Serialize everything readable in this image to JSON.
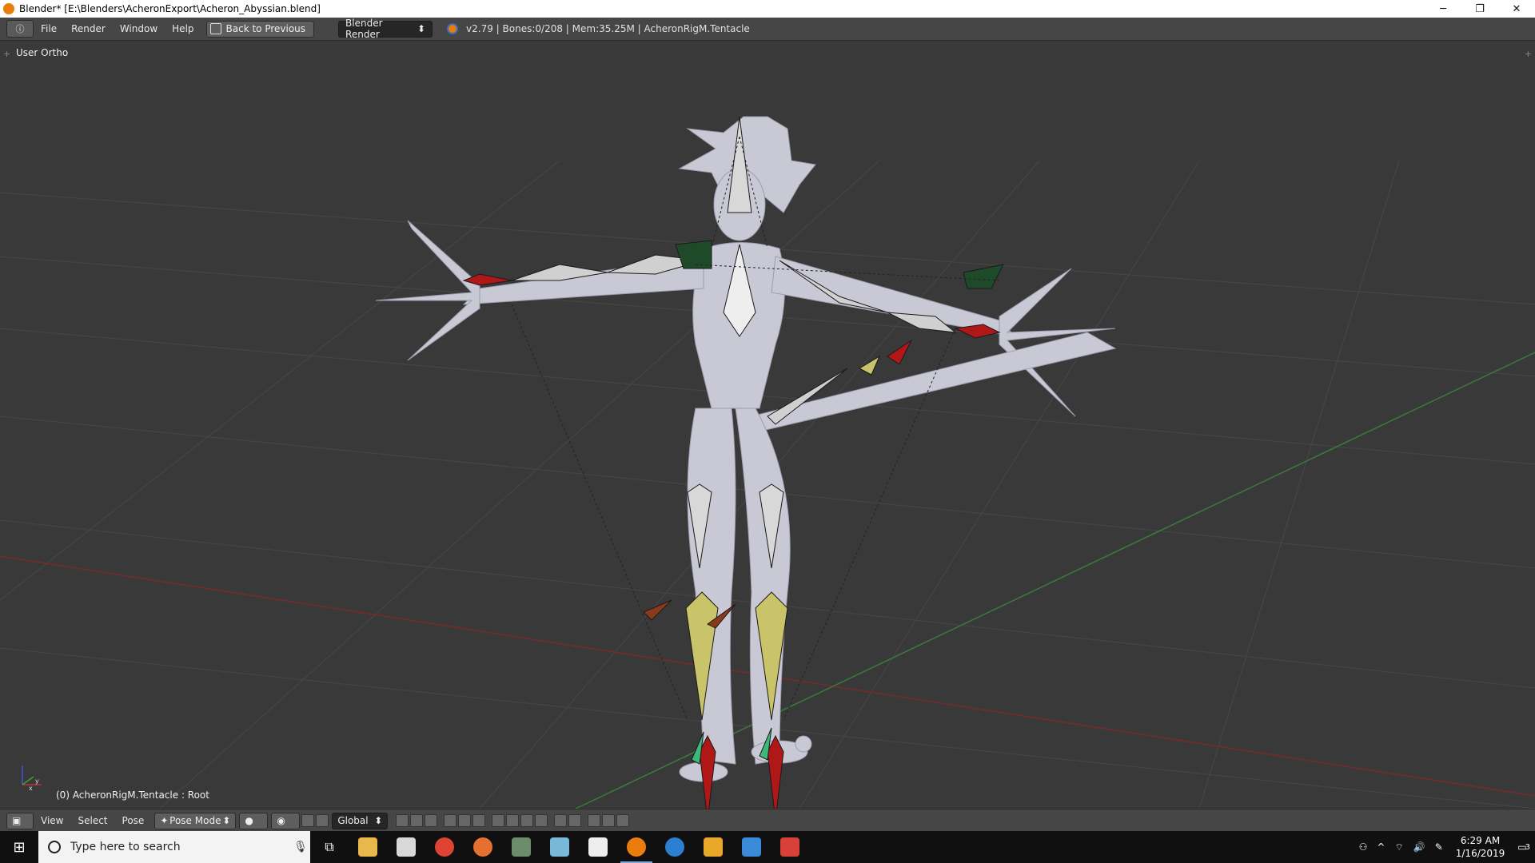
{
  "window": {
    "title": "Blender* [E:\\Blenders\\AcheronExport\\Acheron_Abyssian.blend]",
    "minimize_label": "─",
    "restore_label": "❐",
    "close_label": "✕"
  },
  "infobar": {
    "editor_type_icon": "ⓘ",
    "menus": [
      "File",
      "Render",
      "Window",
      "Help"
    ],
    "back_button": "Back to Previous",
    "render_engine": "Blender Render",
    "stats": "v2.79 | Bones:0/208 | Mem:35.25M | AcheronRigM.Tentacle"
  },
  "viewport": {
    "view_label": "User Ortho",
    "status": "(0) AcheronRigM.Tentacle : Root",
    "axis_x_label": "x",
    "axis_y_label": "y"
  },
  "header": {
    "menus": [
      "View",
      "Select",
      "Pose"
    ],
    "mode": "Pose Mode",
    "orientation": "Global"
  },
  "taskbar": {
    "search_placeholder": "Type here to search",
    "time": "6:29 AM",
    "date": "1/16/2019",
    "notification_count": "3"
  },
  "colors": {
    "viewport_bg": "#393939",
    "grid": "#4a4a4a",
    "x_axis": "#8b2b2b",
    "y_axis": "#3c8a3c",
    "mesh": "#c8c8d6",
    "bone_yellow": "#c9c36a",
    "bone_red": "#b01818",
    "bone_green": "#1f5a2c"
  }
}
